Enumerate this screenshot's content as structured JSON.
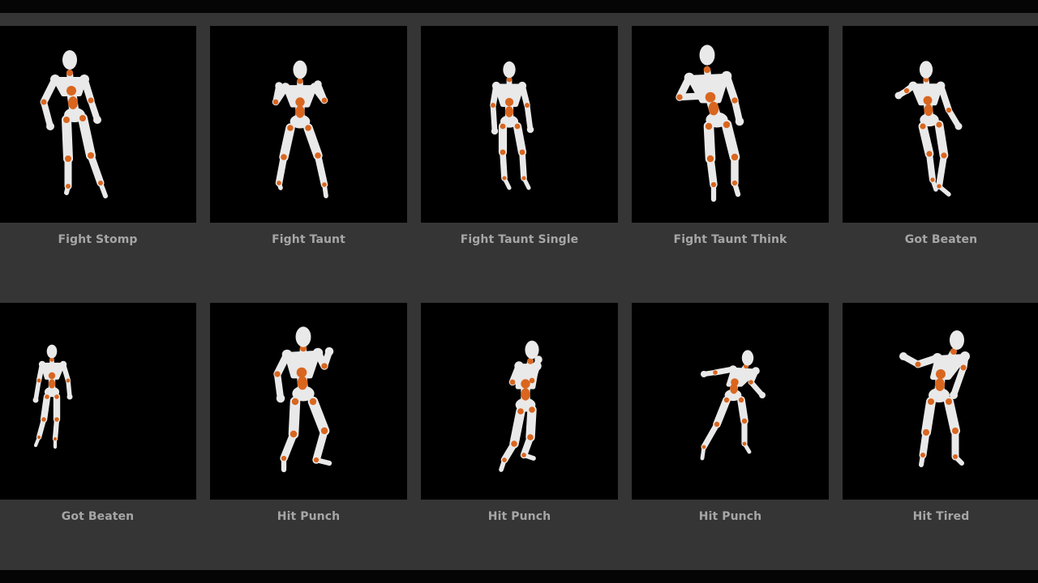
{
  "colors": {
    "page_background": "#353535",
    "frame": "#050505",
    "thumbnail_background": "#000000",
    "label_text": "#a6a6a6",
    "mannequin_body": "#e9e9e9",
    "mannequin_joint": "#d9661f"
  },
  "gallery": {
    "items": [
      {
        "label": "Fight Stomp",
        "pose": "stomp"
      },
      {
        "label": "Fight Taunt",
        "pose": "taunt"
      },
      {
        "label": "Fight Taunt Single",
        "pose": "stand"
      },
      {
        "label": "Fight Taunt Think",
        "pose": "think"
      },
      {
        "label": "Got Beaten",
        "pose": "stagger"
      },
      {
        "label": "Got Beaten",
        "pose": "small"
      },
      {
        "label": "Hit Punch",
        "pose": "punch"
      },
      {
        "label": "Hit Punch",
        "pose": "side"
      },
      {
        "label": "Hit Punch",
        "pose": "arms-out"
      },
      {
        "label": "Hit Tired",
        "pose": "tired"
      }
    ]
  }
}
